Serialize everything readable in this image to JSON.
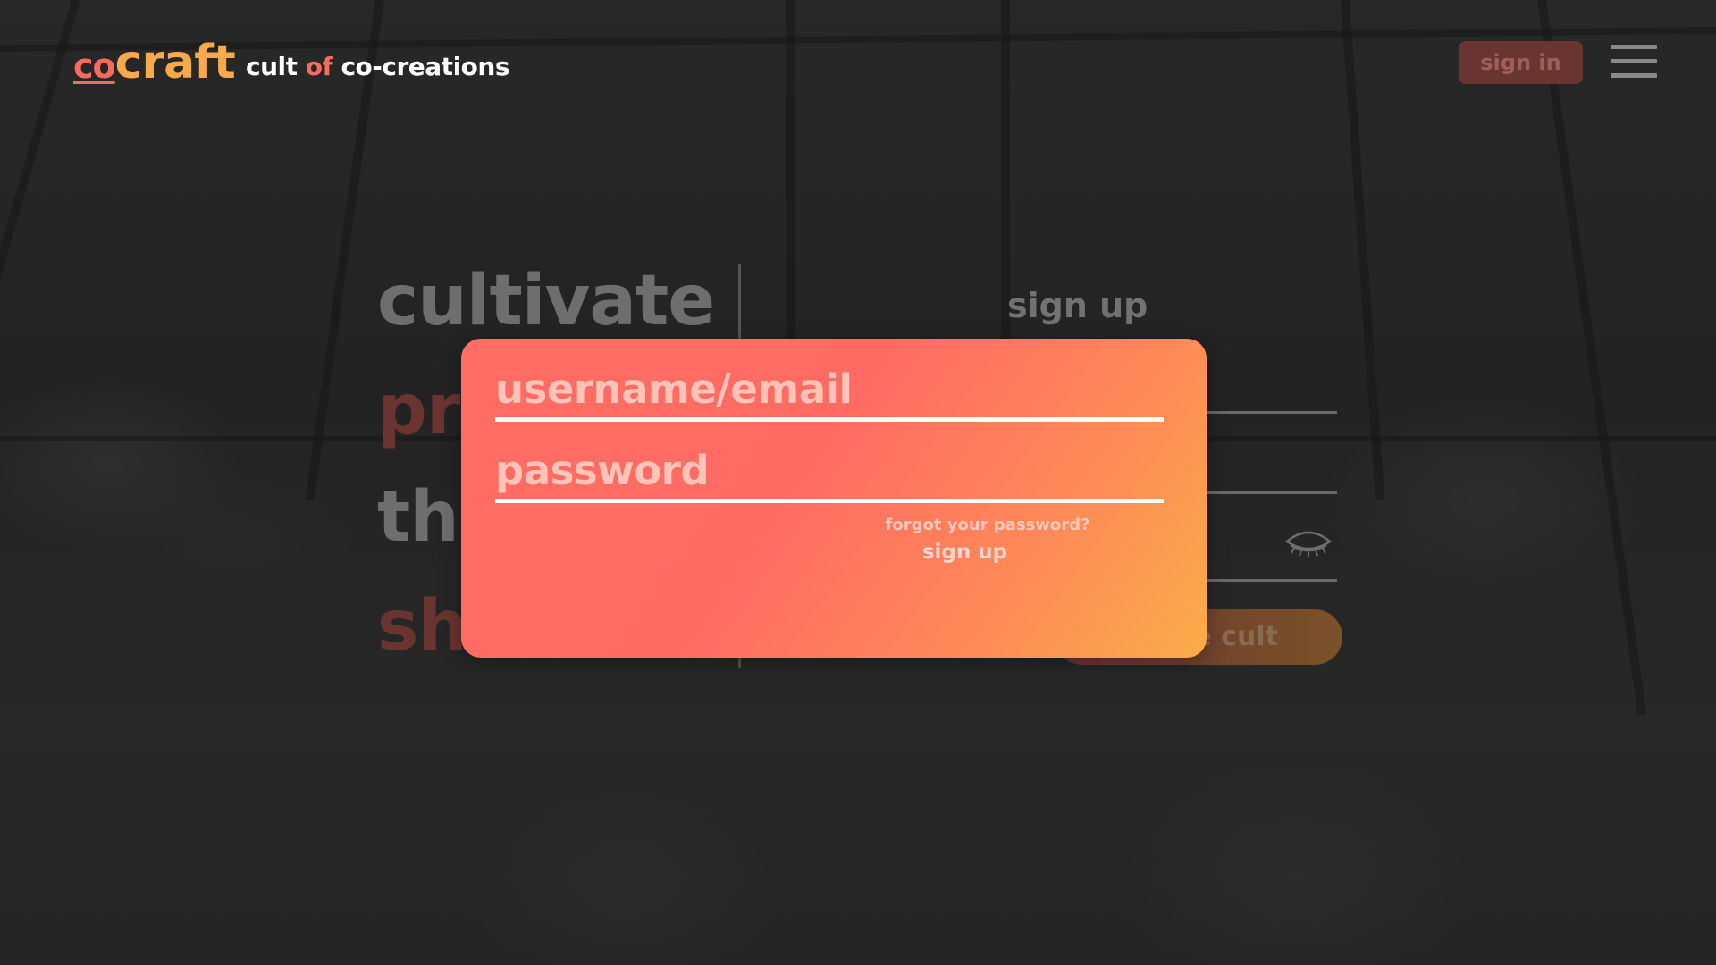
{
  "header": {
    "logo_co": "co",
    "logo_craft": "craft",
    "tagline_part1": "cult",
    "tagline_of": "of",
    "tagline_part2": "co-creations",
    "signin_label": "sign in",
    "menu_icon": "hamburger-menu-icon"
  },
  "hero": {
    "words": [
      "cultivate",
      "pr",
      "thr",
      "sh"
    ]
  },
  "signup_form": {
    "title": "sign up",
    "join_label": "e cult",
    "password_visibility_icon": "eye-closed-icon"
  },
  "login_modal": {
    "username_placeholder": "username/email",
    "password_placeholder": "password",
    "forgot_label": "forgot your password?",
    "signup_link": "sign up"
  },
  "colors": {
    "accent_red": "#f46c5e",
    "accent_orange": "#f7a94b",
    "modal_gradient_start": "#ff6d64",
    "modal_gradient_end": "#f9ad48"
  }
}
